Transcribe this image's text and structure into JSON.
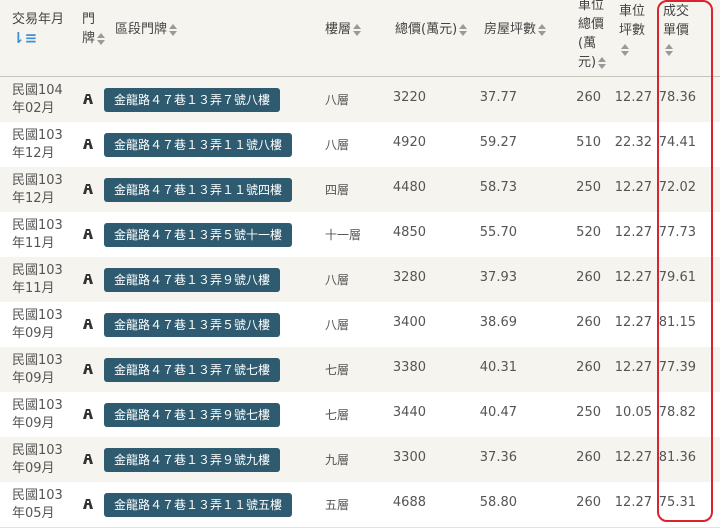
{
  "header": {
    "date": "交易年月",
    "door": "門",
    "door2": "牌",
    "address": "區段門牌",
    "floor": "樓層",
    "total": "總價(萬元)",
    "area": "房屋坪數",
    "parking_unit_1": "車位",
    "parking_unit_2": "總價",
    "parking_unit_3": "(萬",
    "parking_unit_4": "元)",
    "parking_area_1": "車位",
    "parking_area_2": "坪數",
    "unit_price_1": "成交",
    "unit_price_2": "單價"
  },
  "rows": [
    {
      "date1": "民國104",
      "date2": "年02月",
      "address": "金龍路４７巷１３弄７號八樓",
      "floor": "八層",
      "total": "3220",
      "area": "37.77",
      "parking_price": "260",
      "parking_area": "12.27",
      "unit_price": "78.36"
    },
    {
      "date1": "民國103",
      "date2": "年12月",
      "address": "金龍路４７巷１３弄１１號八樓",
      "floor": "八層",
      "total": "4920",
      "area": "59.27",
      "parking_price": "510",
      "parking_area": "22.32",
      "unit_price": "74.41"
    },
    {
      "date1": "民國103",
      "date2": "年12月",
      "address": "金龍路４７巷１３弄１１號四樓",
      "floor": "四層",
      "total": "4480",
      "area": "58.73",
      "parking_price": "250",
      "parking_area": "12.27",
      "unit_price": "72.02"
    },
    {
      "date1": "民國103",
      "date2": "年11月",
      "address": "金龍路４７巷１３弄５號十一樓",
      "floor": "十一層",
      "total": "4850",
      "area": "55.70",
      "parking_price": "520",
      "parking_area": "12.27",
      "unit_price": "77.73"
    },
    {
      "date1": "民國103",
      "date2": "年11月",
      "address": "金龍路４７巷１３弄９號八樓",
      "floor": "八層",
      "total": "3280",
      "area": "37.93",
      "parking_price": "260",
      "parking_area": "12.27",
      "unit_price": "79.61"
    },
    {
      "date1": "民國103",
      "date2": "年09月",
      "address": "金龍路４７巷１３弄５號八樓",
      "floor": "八層",
      "total": "3400",
      "area": "38.69",
      "parking_price": "260",
      "parking_area": "12.27",
      "unit_price": "81.15"
    },
    {
      "date1": "民國103",
      "date2": "年09月",
      "address": "金龍路４７巷１３弄７號七樓",
      "floor": "七層",
      "total": "3380",
      "area": "40.31",
      "parking_price": "260",
      "parking_area": "12.27",
      "unit_price": "77.39"
    },
    {
      "date1": "民國103",
      "date2": "年09月",
      "address": "金龍路４７巷１３弄９號七樓",
      "floor": "七層",
      "total": "3440",
      "area": "40.47",
      "parking_price": "250",
      "parking_area": "10.05",
      "unit_price": "78.82"
    },
    {
      "date1": "民國103",
      "date2": "年09月",
      "address": "金龍路４７巷１３弄９號九樓",
      "floor": "九層",
      "total": "3300",
      "area": "37.36",
      "parking_price": "260",
      "parking_area": "12.27",
      "unit_price": "81.36"
    },
    {
      "date1": "民國103",
      "date2": "年05月",
      "address": "金龍路４７巷１３弄１１號五樓",
      "floor": "五層",
      "total": "4688",
      "area": "58.80",
      "parking_price": "260",
      "parking_area": "12.27",
      "unit_price": "75.31"
    }
  ],
  "icons": {
    "sort": "sort-arrows-icon",
    "sort_desc": "sort-desc-icon",
    "building": "building-icon"
  },
  "colors": {
    "address_badge": "#2e5b70",
    "highlight": "#d9232e",
    "sort_active": "#3f8ed6"
  }
}
